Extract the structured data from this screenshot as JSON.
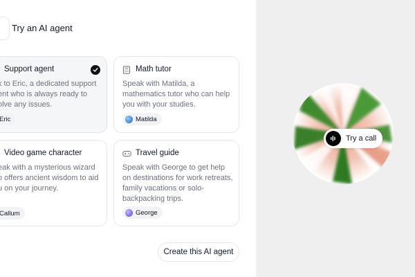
{
  "header": {
    "title": "Try an AI agent"
  },
  "agents": [
    {
      "title": "Support agent",
      "description_lines": [
        "k to Eric, a dedicated support",
        "ent who is always ready to",
        "olve any issues."
      ],
      "voice": "Eric",
      "selected": true,
      "icon": "support-icon",
      "avatar_color": "#f2f3f5"
    },
    {
      "title": "Math tutor",
      "description_lines": [
        "Speak with Matilda, a",
        "mathematics tutor who can help",
        "you with your studies."
      ],
      "voice": "Matilda",
      "selected": false,
      "icon": "calculator-icon",
      "avatar_color": "#2f7bd6"
    },
    {
      "title": "Video game character",
      "description_lines": [
        "eak with a mysterious wizard",
        "o offers ancient wisdom to aid",
        "u on your journey."
      ],
      "voice": "Callum",
      "selected": false,
      "icon": "wizard-icon",
      "avatar_color": "#f2f3f5"
    },
    {
      "title": "Travel guide",
      "description_lines": [
        "Speak with George to get help",
        "on destinations for work retreats,",
        "family vacations or solo-",
        "backpacking trips."
      ],
      "voice": "George",
      "selected": false,
      "icon": "gamepad-icon",
      "avatar_color": "#7c5cf0"
    }
  ],
  "actions": {
    "create_label": "Create this AI agent"
  },
  "call": {
    "label": "Try a call",
    "icon": "waveform-icon"
  },
  "colors": {
    "orb_green": "#3f8a2e",
    "orb_pink": "#e9a08a",
    "accent": "#111111"
  }
}
